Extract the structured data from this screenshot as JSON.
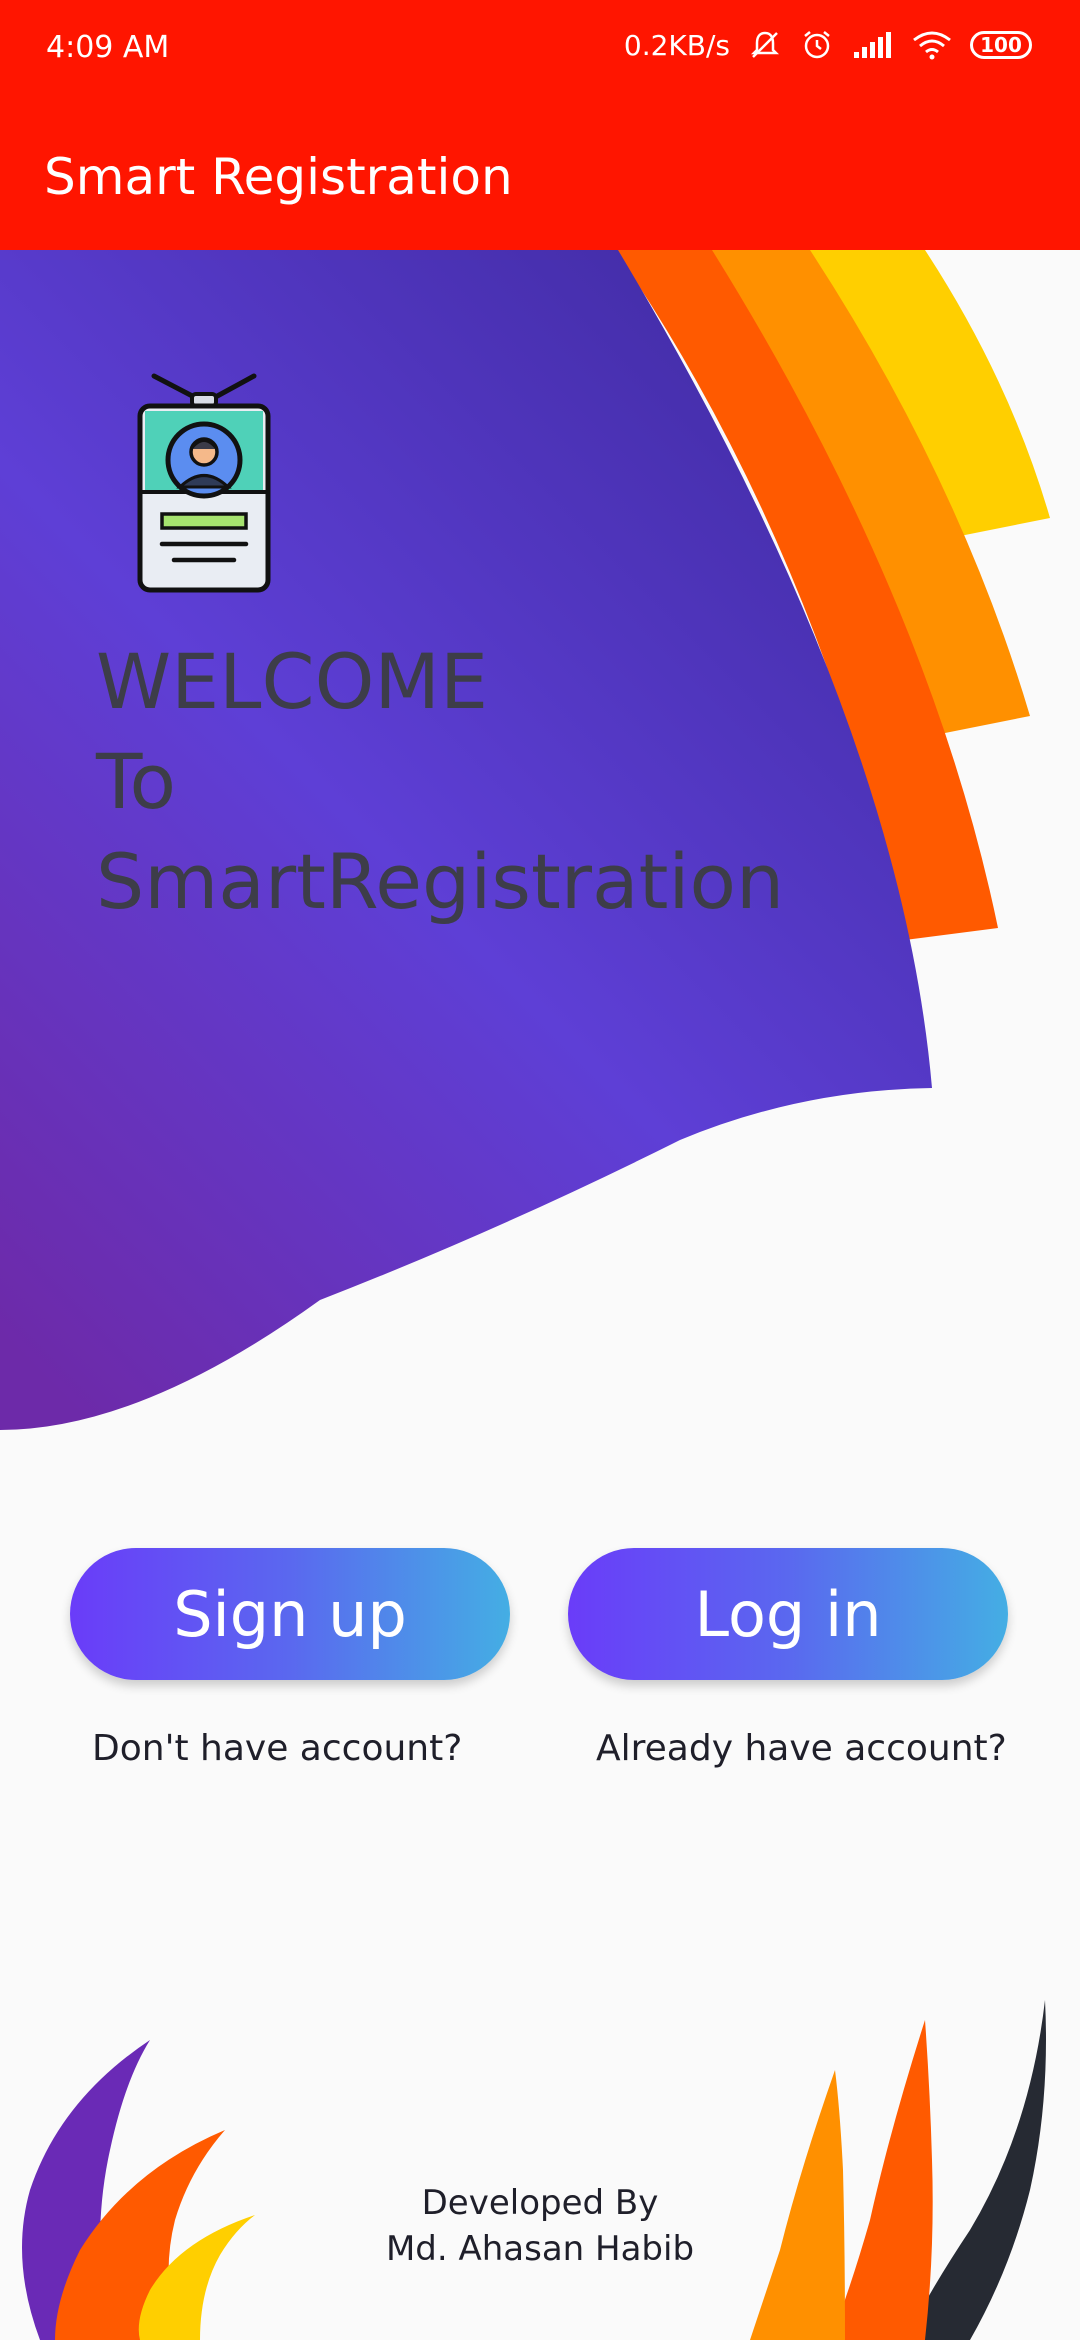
{
  "status_bar": {
    "time": "4:09 AM",
    "network_speed": "0.2KB/s",
    "battery_level": "100",
    "icons": [
      "mute-icon",
      "alarm-icon",
      "signal-icon",
      "wifi-icon",
      "battery-icon"
    ]
  },
  "app_bar": {
    "title": "Smart Registration"
  },
  "hero": {
    "icon": "id-badge-icon",
    "welcome_line1": "WELCOME",
    "welcome_line2": "To",
    "welcome_line3": "SmartRegistration"
  },
  "actions": {
    "signup_label": "Sign up",
    "signup_hint": "Don't have account?",
    "login_label": "Log in",
    "login_hint": "Already have account?"
  },
  "footer": {
    "line1": "Developed By",
    "line2": "Md. Ahasan Habib"
  },
  "colors": {
    "app_bar": "#ff1500",
    "hero_purple": "#5b3fd6",
    "orange": "#ff5a00",
    "amber": "#ff9000",
    "yellow": "#ffcf00",
    "button_start": "#6a3cf9",
    "button_end": "#44aee4"
  }
}
